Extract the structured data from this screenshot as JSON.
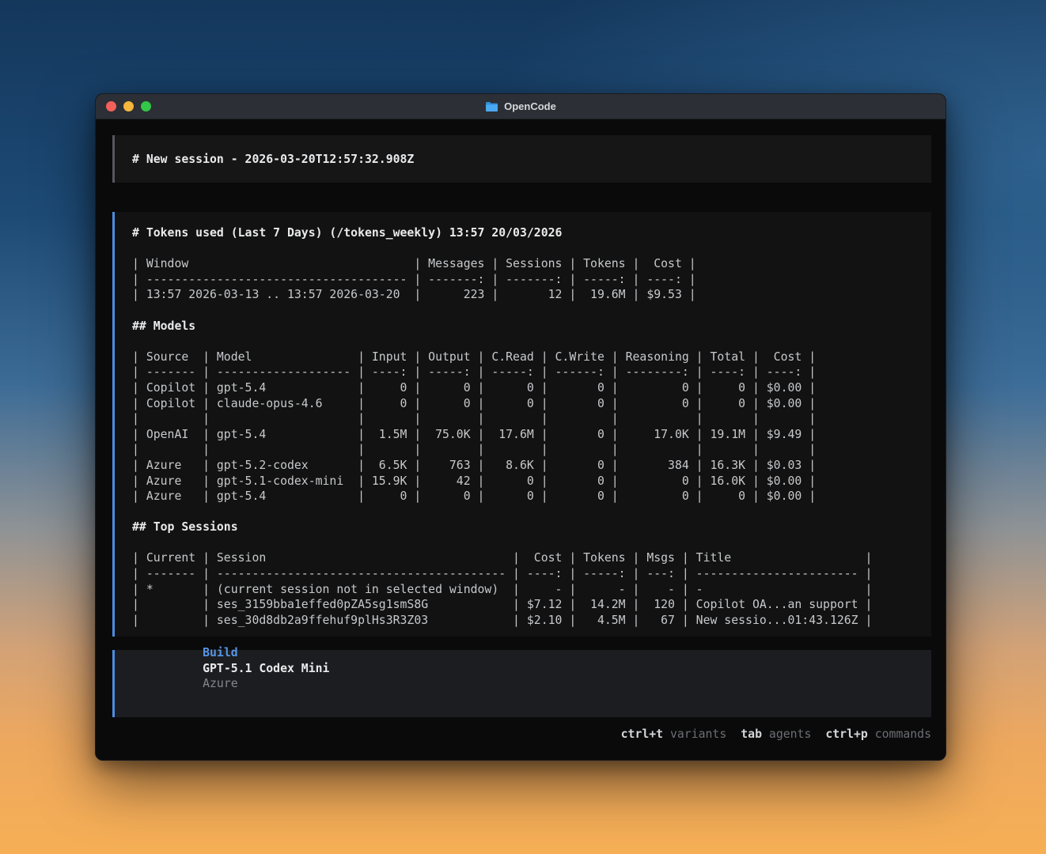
{
  "window": {
    "title": "OpenCode"
  },
  "session_header": {
    "text": "# New session - 2026-03-20T12:57:32.908Z"
  },
  "tokens_block": {
    "lines": [
      {
        "t": "# Tokens used (Last 7 Days) (/tokens_weekly) 13:57 20/03/2026",
        "s": "h"
      },
      {
        "t": "",
        "s": "n"
      },
      {
        "t": "| Window                                | Messages | Sessions | Tokens |  Cost |",
        "s": "n"
      },
      {
        "t": "| ------------------------------------- | -------: | -------: | -----: | ----: |",
        "s": "n"
      },
      {
        "t": "| 13:57 2026-03-13 .. 13:57 2026-03-20  |      223 |       12 |  19.6M | $9.53 |",
        "s": "n"
      },
      {
        "t": "",
        "s": "n"
      },
      {
        "t": "## Models",
        "s": "h"
      },
      {
        "t": "",
        "s": "n"
      },
      {
        "t": "| Source  | Model               | Input | Output | C.Read | C.Write | Reasoning | Total |  Cost |",
        "s": "n"
      },
      {
        "t": "| ------- | ------------------- | ----: | -----: | -----: | ------: | --------: | ----: | ----: |",
        "s": "n"
      },
      {
        "t": "| Copilot | gpt-5.4             |     0 |      0 |      0 |       0 |         0 |     0 | $0.00 |",
        "s": "n"
      },
      {
        "t": "| Copilot | claude-opus-4.6     |     0 |      0 |      0 |       0 |         0 |     0 | $0.00 |",
        "s": "n"
      },
      {
        "t": "|         |                     |       |        |        |         |           |       |       |",
        "s": "n"
      },
      {
        "t": "| OpenAI  | gpt-5.4             |  1.5M |  75.0K |  17.6M |       0 |     17.0K | 19.1M | $9.49 |",
        "s": "n"
      },
      {
        "t": "|         |                     |       |        |        |         |           |       |       |",
        "s": "n"
      },
      {
        "t": "| Azure   | gpt-5.2-codex       |  6.5K |    763 |   8.6K |       0 |       384 | 16.3K | $0.03 |",
        "s": "n"
      },
      {
        "t": "| Azure   | gpt-5.1-codex-mini  | 15.9K |     42 |      0 |       0 |         0 | 16.0K | $0.00 |",
        "s": "n"
      },
      {
        "t": "| Azure   | gpt-5.4             |     0 |      0 |      0 |       0 |         0 |     0 | $0.00 |",
        "s": "n"
      },
      {
        "t": "",
        "s": "n"
      },
      {
        "t": "## Top Sessions",
        "s": "h"
      },
      {
        "t": "",
        "s": "n"
      },
      {
        "t": "| Current | Session                                   |  Cost | Tokens | Msgs | Title                   |",
        "s": "n"
      },
      {
        "t": "| ------- | ----------------------------------------- | ----: | -----: | ---: | ----------------------- |",
        "s": "n"
      },
      {
        "t": "| *       | (current session not in selected window)  |     - |      - |    - | -                       |",
        "s": "n"
      },
      {
        "t": "|         | ses_3159bba1effed0pZA5sg1smS8G            | $7.12 |  14.2M |  120 | Copilot OA...an support |",
        "s": "n"
      },
      {
        "t": "|         | ses_30d8db2a9ffehuf9plHs3R3Z03            | $2.10 |   4.5M |   67 | New sessio...01:43.126Z |",
        "s": "n"
      }
    ]
  },
  "input_bar": {
    "mode": "Build",
    "model": "GPT-5.1 Codex Mini",
    "provider": "Azure"
  },
  "status_bar": {
    "items": [
      {
        "key": "ctrl+t",
        "label": "variants"
      },
      {
        "key": "tab",
        "label": "agents"
      },
      {
        "key": "ctrl+p",
        "label": "commands"
      }
    ]
  },
  "colors": {
    "traffic-red": "#f4605a",
    "traffic-yellow": "#f6b53c",
    "traffic-green": "#33c748",
    "accent-blue": "#4b8ce2",
    "folder-blue": "#4aa8f0",
    "titlebar-bg": "#2c2f35",
    "terminal-bg": "#0a0a0b",
    "block-bg": "#121212",
    "session-bg": "#161616",
    "input-bg": "#1c1d20",
    "text-bright": "#e9eaec",
    "text-normal": "#c7c9cc"
  }
}
